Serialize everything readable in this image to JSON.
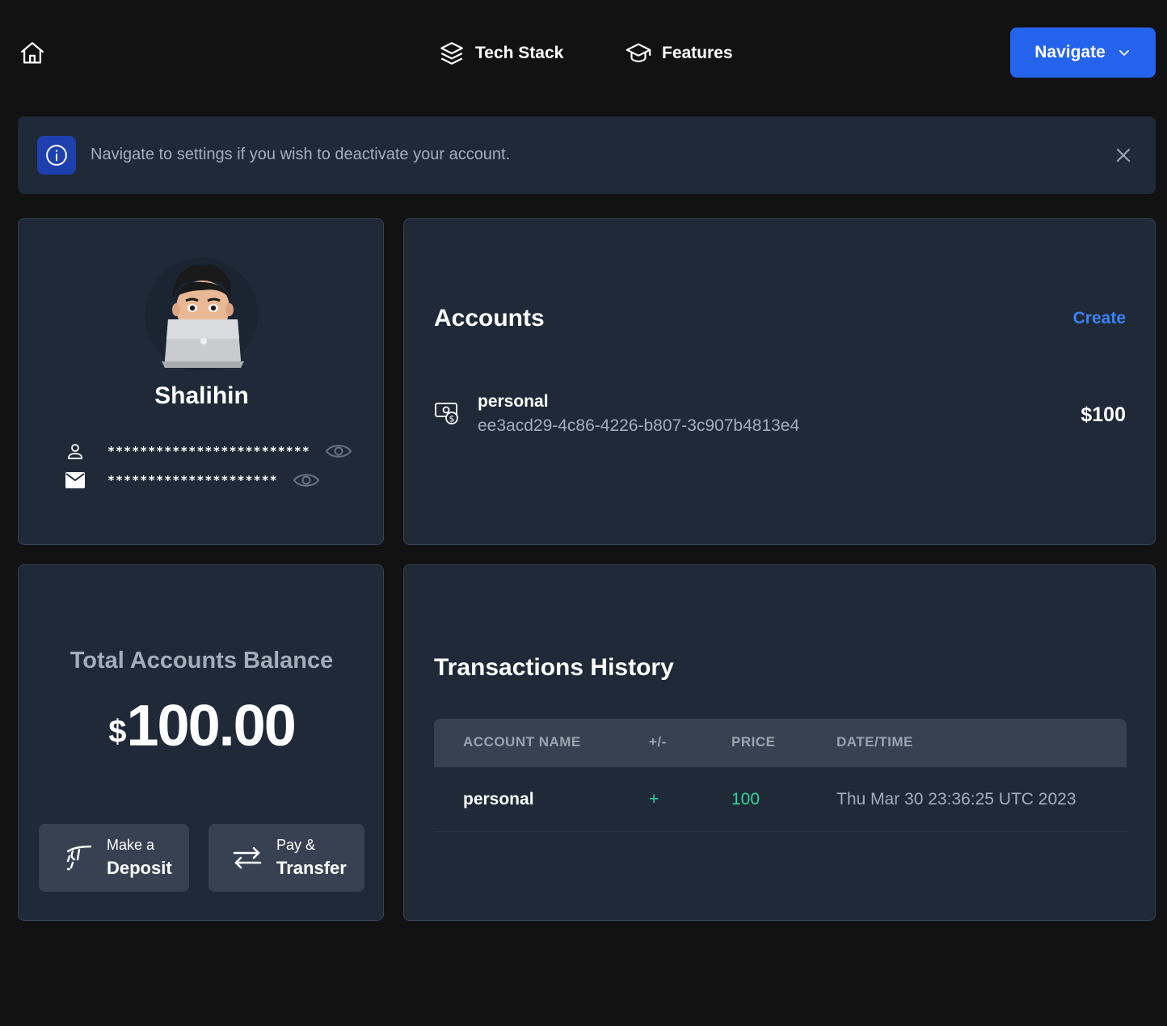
{
  "nav": {
    "tech_stack": "Tech Stack",
    "features": "Features",
    "navigate": "Navigate"
  },
  "alert": {
    "message": "Navigate to settings if you wish to deactivate your account."
  },
  "profile": {
    "name": "Shalihin",
    "username_masked": "*************************",
    "email_masked": "*********************"
  },
  "accounts": {
    "title": "Accounts",
    "create_label": "Create",
    "items": [
      {
        "name": "personal",
        "id": "ee3acd29-4c86-4226-b807-3c907b4813e4",
        "balance": "$100"
      }
    ]
  },
  "balance": {
    "label": "Total Accounts Balance",
    "currency": "$",
    "amount": "100.00",
    "deposit": {
      "line1": "Make a",
      "line2": "Deposit"
    },
    "transfer": {
      "line1": "Pay &",
      "line2": "Transfer"
    }
  },
  "transactions": {
    "title": "Transactions History",
    "columns": [
      "ACCOUNT NAME",
      "+/-",
      "PRICE",
      "DATE/TIME"
    ],
    "rows": [
      [
        "personal",
        "+",
        "100",
        "Thu Mar 30 23:36:25 UTC 2023"
      ]
    ]
  },
  "colors": {
    "background": "#121212",
    "card": "#1f2937",
    "accent": "#2463eb",
    "link": "#3b82f6",
    "positive": "#34d399"
  }
}
